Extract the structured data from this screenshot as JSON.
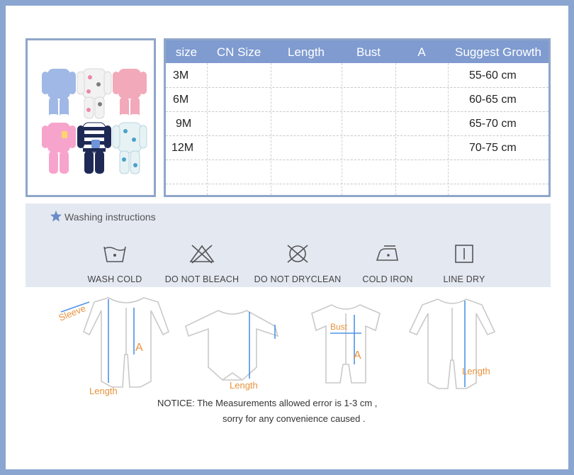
{
  "table": {
    "headers": [
      "size",
      "CN Size",
      "Length",
      "Bust",
      "A",
      "Suggest Growth"
    ],
    "rows": [
      {
        "size": "3M",
        "growth": "55-60 cm"
      },
      {
        "size": "6M",
        "growth": "60-65 cm"
      },
      {
        "size": "9M",
        "growth": "65-70 cm"
      },
      {
        "size": "12M",
        "growth": "70-75 cm"
      }
    ]
  },
  "washing": {
    "title": "Washing instructions",
    "items": [
      {
        "label": "WASH COLD",
        "icon": "wash-cold-icon"
      },
      {
        "label": "DO NOT BLEACH",
        "icon": "no-bleach-icon"
      },
      {
        "label": "DO NOT DRYCLEAN",
        "icon": "no-dryclean-icon"
      },
      {
        "label": "COLD IRON",
        "icon": "cold-iron-icon"
      },
      {
        "label": "LINE DRY",
        "icon": "line-dry-icon"
      }
    ]
  },
  "diagram_labels": {
    "sleeve": "Sleeve",
    "a": "A",
    "length": "Length",
    "bust": "Bust"
  },
  "notice": {
    "line1": "NOTICE:   The Measurements allowed error is 1-3 cm ,",
    "line2": "sorry for any convenience caused ."
  },
  "colors": {
    "header_bg": "#7f9bd0",
    "border": "#8fa6c9",
    "measure_line": "#4f93e6",
    "label_orange": "#e8923c"
  }
}
